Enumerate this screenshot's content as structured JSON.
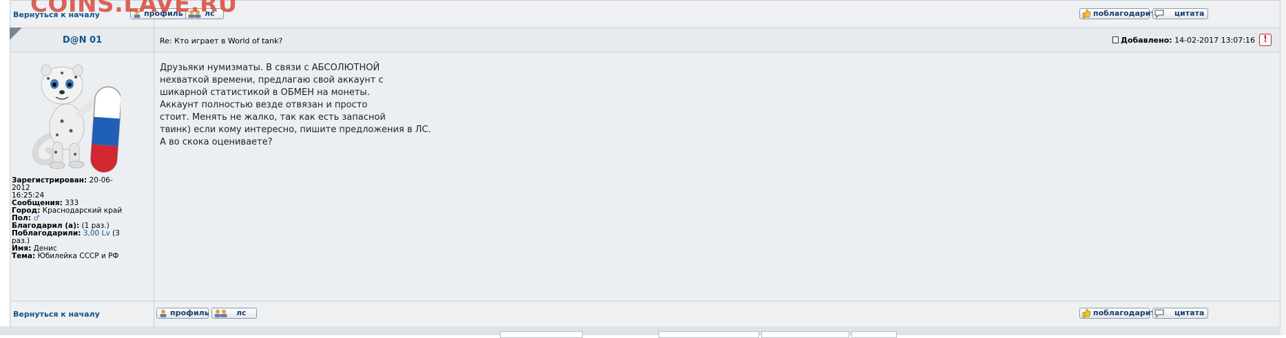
{
  "watermark": "COINS.LAVE.RU",
  "nav": {
    "back_to_top": "Вернуться к началу",
    "profile": "профиль",
    "pm": "лс",
    "thank": "поблагодарить",
    "quote": "цитата"
  },
  "post": {
    "author": "D@N 01",
    "subject": "Re: Кто играет в World of tank?",
    "added_label": "Добавлено:",
    "added_date": "14-02-2017 13:07:16",
    "report_symbol": "!",
    "message_lines": [
      "Друзьяки нумизматы. В связи с АБСОЛЮТНОЙ",
      "нехваткой времени, предлагаю свой аккаунт с",
      "шикарной статистикой в ОБМЕН на монеты.",
      "Аккаунт полностью везде отвязан и просто",
      "стоит. Менять не жалко, так как есть запасной",
      "твинк) если кому интересно, пишите предложения в ЛС.",
      "А во скока оцениваете?"
    ]
  },
  "profile": {
    "registered_label": "Зарегистрирован:",
    "registered_value": "20-06-2012",
    "registered_time": "16:25:24",
    "messages_label": "Сообщения:",
    "messages_value": "333",
    "city_label": "Город:",
    "city_value": "Краснодарский край",
    "gender_label": "Пол:",
    "gender_icon": "male-symbol-icon",
    "thanked_label": "Благодарил (а):",
    "thanked_value": "(1 раз.)",
    "thanked_by_label": "Поблагодарили:",
    "thanked_by_value": "3,00 Lv",
    "thanked_by_count": "(3",
    "thanked_by_count2": "раз.)",
    "name_label": "Имя:",
    "name_value": "Денис",
    "theme_label": "Тема:",
    "theme_value": "Юбилейка СССР и РФ"
  },
  "colors": {
    "link": "#105289",
    "watermark": "#d9574a",
    "background": "#eceff1"
  }
}
